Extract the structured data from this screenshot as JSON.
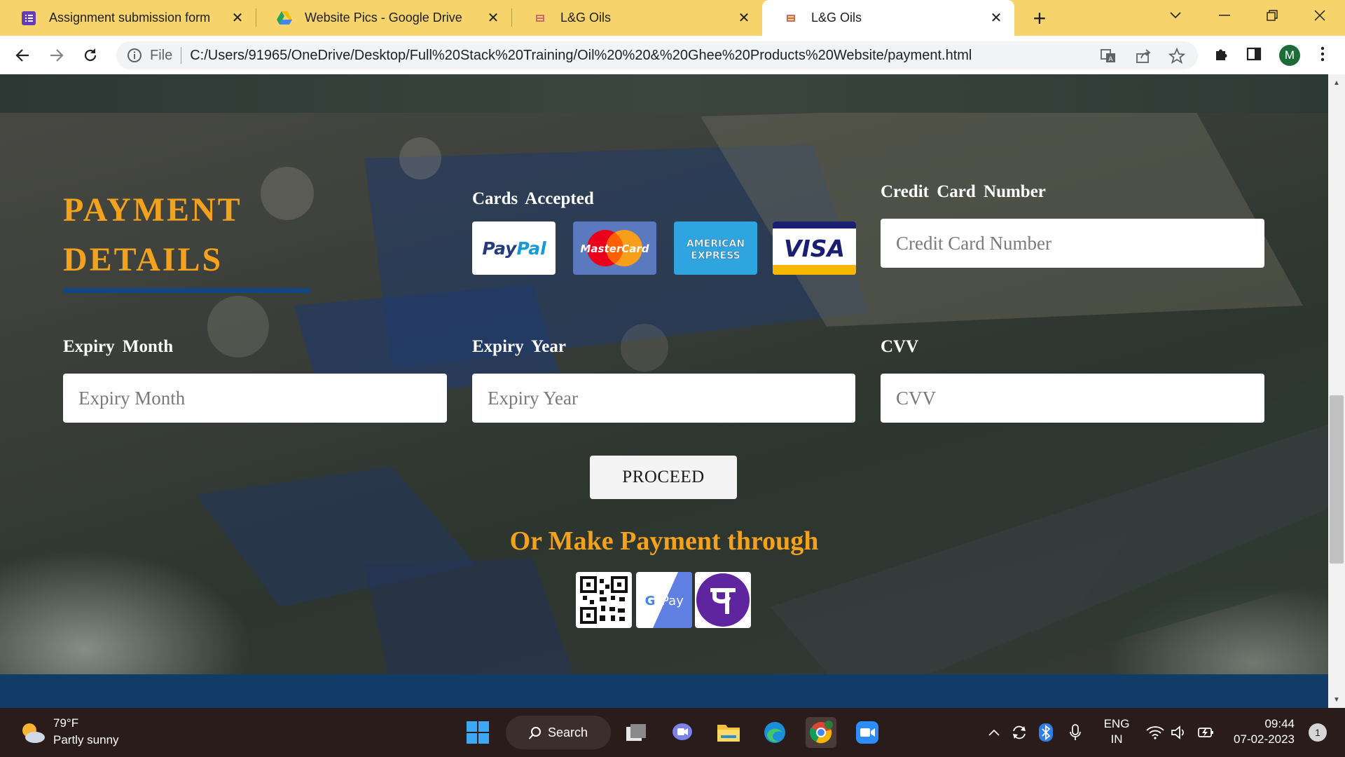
{
  "browser": {
    "tabs": [
      {
        "title": "Assignment submission form",
        "icon": "google-forms-icon"
      },
      {
        "title": "Website Pics - Google Drive",
        "icon": "google-drive-icon"
      },
      {
        "title": "L&G Oils",
        "icon": "site-favicon"
      },
      {
        "title": "L&G Oils",
        "icon": "site-favicon",
        "active": true
      }
    ],
    "address": {
      "scheme_label": "File",
      "url": "C:/Users/91965/OneDrive/Desktop/Full%20Stack%20Training/Oil%20%20&%20Ghee%20Products%20Website/payment.html"
    },
    "profile_initial": "M"
  },
  "page": {
    "heading_line1": "PAYMENT",
    "heading_line2": "DETAILS",
    "cards_accepted_label": "Cards  Accepted",
    "cards": [
      "PayPal",
      "MasterCard",
      "AMERICAN EXPRESS",
      "VISA"
    ],
    "credit_card": {
      "label": "Credit  Card  Number",
      "placeholder": "Credit Card Number",
      "value": ""
    },
    "expiry_month": {
      "label": "Expiry  Month",
      "placeholder": "Expiry Month",
      "value": ""
    },
    "expiry_year": {
      "label": "Expiry  Year",
      "placeholder": "Expiry Year",
      "value": ""
    },
    "cvv": {
      "label": "CVV",
      "placeholder": "CVV",
      "value": ""
    },
    "proceed_label": "PROCEED",
    "alt_payment_heading": "Or Make Payment through",
    "alt_payment_methods": [
      "qr-code-icon",
      "google-pay-icon",
      "phonepe-icon"
    ],
    "colors": {
      "accent": "#f3a21d",
      "underline": "#134782",
      "footer": "#123c68"
    }
  },
  "taskbar": {
    "weather_temp": "79°F",
    "weather_desc": "Partly sunny",
    "search_label": "Search",
    "lang_line1": "ENG",
    "lang_line2": "IN",
    "time": "09:44",
    "date": "07-02-2023",
    "notifications": "1"
  }
}
